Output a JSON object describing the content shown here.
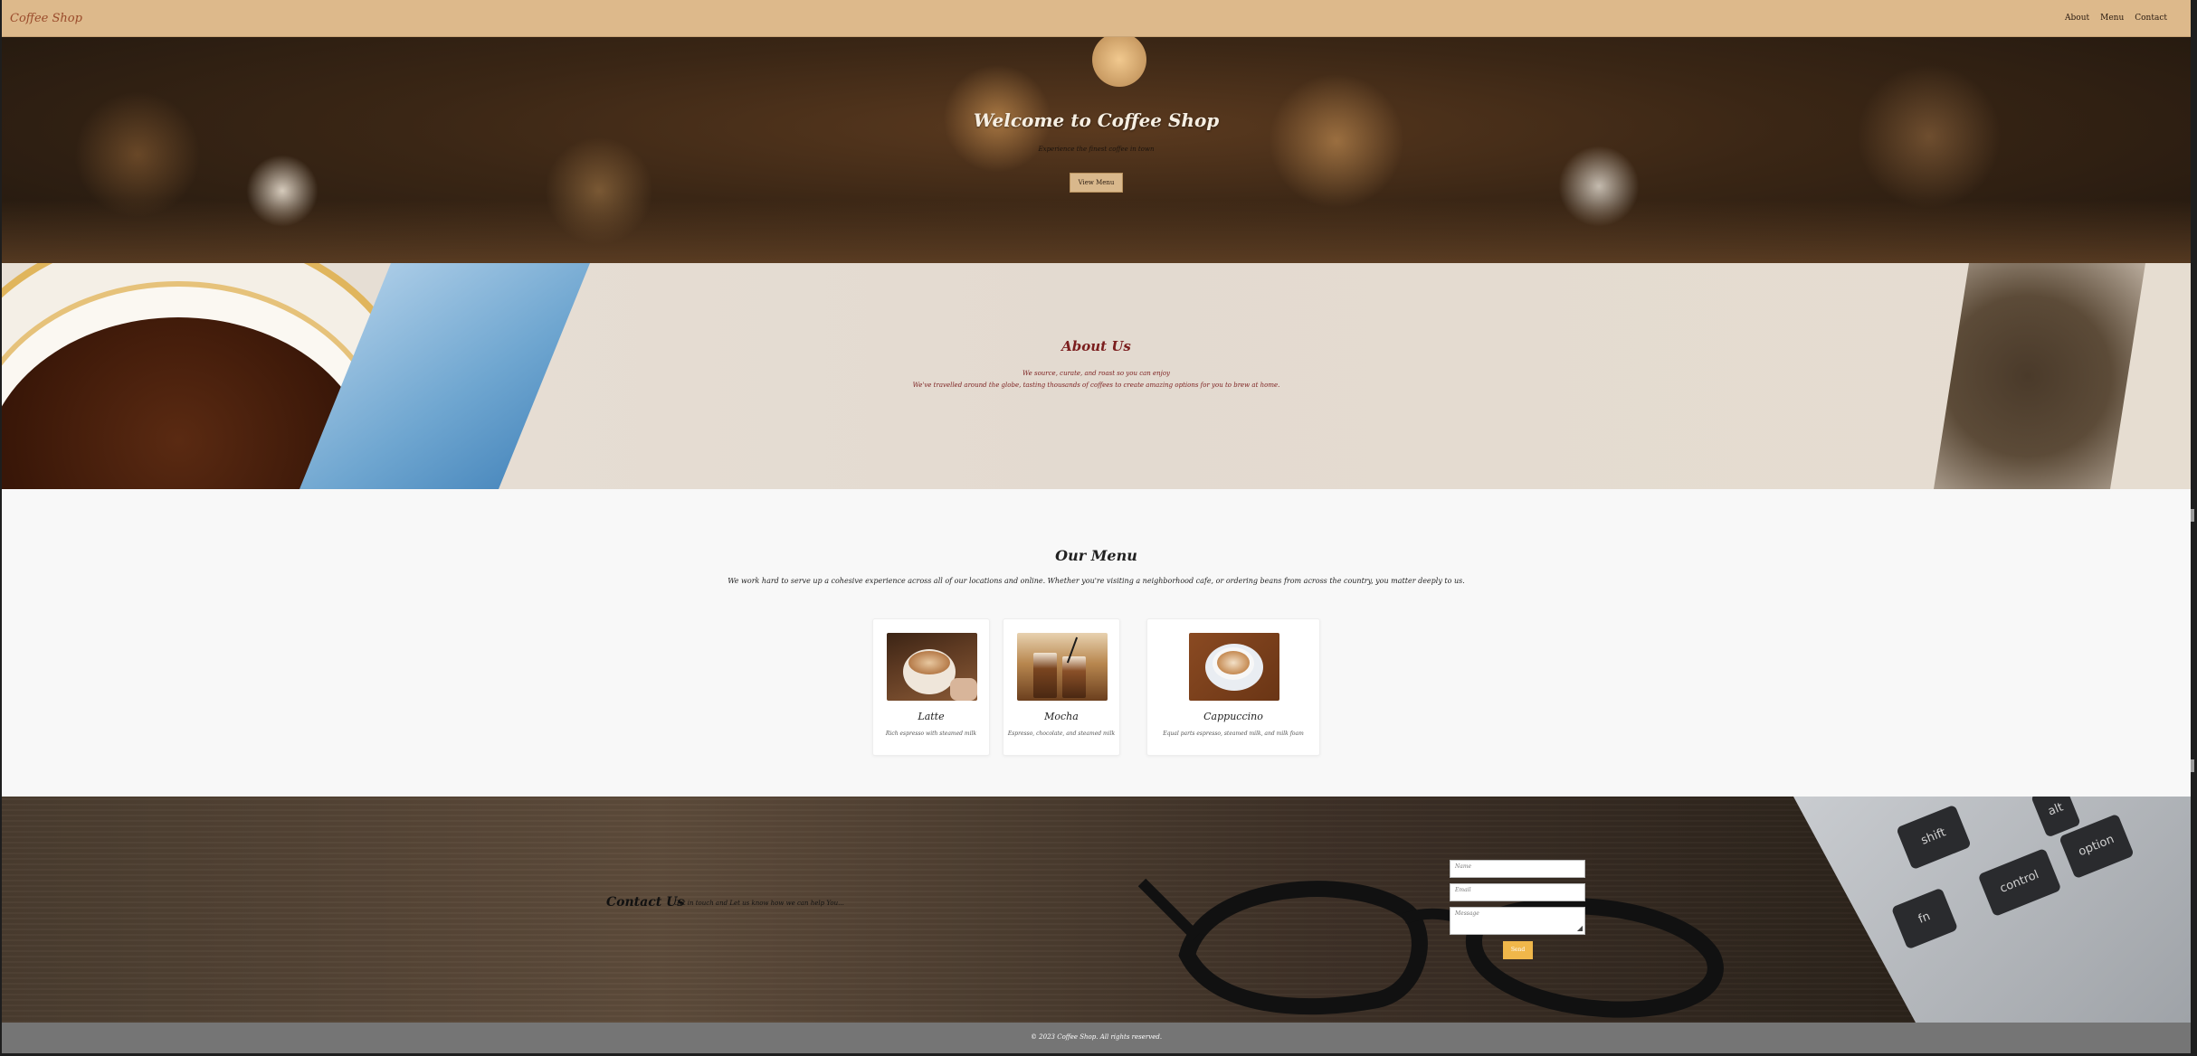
{
  "header": {
    "logo": "Coffee Shop",
    "nav": [
      "About",
      "Menu",
      "Contact"
    ]
  },
  "hero": {
    "title": "Welcome to Coffee Shop",
    "subtitle": "Experience the finest coffee in town",
    "button": "View Menu"
  },
  "about": {
    "title": "About Us",
    "lines": [
      "We source, curate, and roast so you can enjoy",
      "We've travelled around the globe, tasting thousands of coffees to create amazing options for you to brew at home."
    ]
  },
  "menu": {
    "title": "Our Menu",
    "text": "We work hard to serve up a cohesive experience across all of our locations and online. Whether you're visiting a neighborhood cafe, or ordering beans from across the country, you matter deeply to us.",
    "items": [
      {
        "name": "Latte",
        "description": "Rich espresso with steamed milk"
      },
      {
        "name": "Mocha",
        "description": "Espresso, chocolate, and steamed milk"
      },
      {
        "name": "Cappuccino",
        "description": "Equal parts espresso, steamed milk, and milk foam"
      }
    ]
  },
  "contact": {
    "title": "Contact Us",
    "subtitle": "Get in touch and Let us know how we can help You...",
    "placeholders": {
      "name": "Name",
      "email": "Email",
      "message": "Message"
    },
    "button": "Send",
    "keys": [
      "shift",
      "alt",
      "option",
      "control",
      "fn"
    ]
  },
  "footer": {
    "text": "© 2023 Coffee Shop. All rights reserved."
  },
  "colors": {
    "header_bg": "#ddb98b",
    "accent_button": "#d9b88c",
    "about_text": "#7b1e1e",
    "send_button": "#f0b74a",
    "footer_bg": "#757575"
  }
}
